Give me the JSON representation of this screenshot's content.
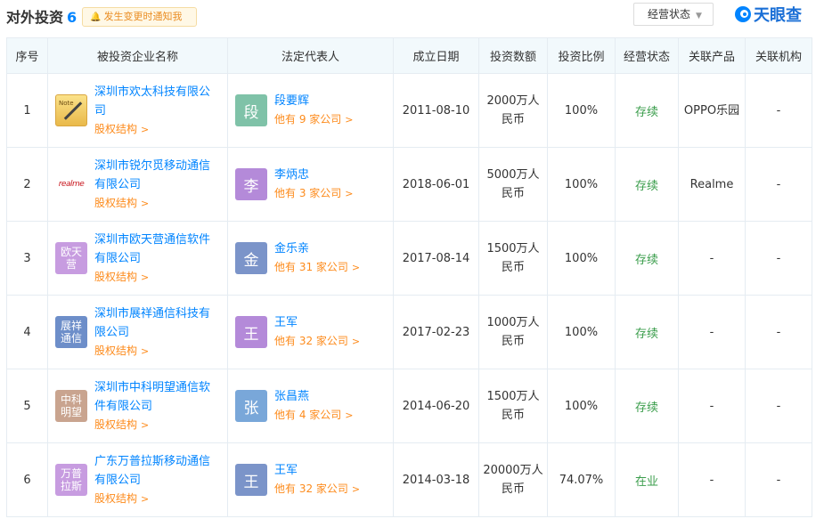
{
  "header": {
    "title": "对外投资",
    "count": "6",
    "notify_label": "发生变更时通知我",
    "status_filter": "经营状态",
    "logo_text": "天眼查"
  },
  "table": {
    "columns": [
      "序号",
      "被投资企业名称",
      "法定代表人",
      "成立日期",
      "投资数额",
      "投资比例",
      "经营状态",
      "关联产品",
      "关联机构"
    ],
    "equity_label": "股权结构",
    "rows": [
      {
        "idx": "1",
        "logo_text": "Note",
        "company": "深圳市欢太科技有限公司",
        "avatar": "段",
        "avatar_color": "#7fc2a8",
        "person": "段要辉",
        "more": "他有 9 家公司",
        "date": "2011-08-10",
        "amount": "2000万人民币",
        "ratio": "100%",
        "status": "存续",
        "product": "OPPO乐园",
        "org": "-"
      },
      {
        "idx": "2",
        "logo_text": "realme",
        "company": "深圳市锐尔觅移动通信有限公司",
        "avatar": "李",
        "avatar_color": "#b48ad9",
        "person": "李炳忠",
        "more": "他有 3 家公司",
        "date": "2018-06-01",
        "amount": "5000万人民币",
        "ratio": "100%",
        "status": "存续",
        "product": "Realme",
        "org": "-"
      },
      {
        "idx": "3",
        "logo_text": "欧天营",
        "company": "深圳市欧天营通信软件有限公司",
        "avatar": "金",
        "avatar_color": "#7b94c9",
        "person": "金乐亲",
        "more": "他有 31 家公司",
        "date": "2017-08-14",
        "amount": "1500万人民币",
        "ratio": "100%",
        "status": "存续",
        "product": "-",
        "org": "-"
      },
      {
        "idx": "4",
        "logo_text": "展祥通信",
        "company": "深圳市展祥通信科技有限公司",
        "avatar": "王",
        "avatar_color": "#b48ad9",
        "person": "王军",
        "more": "他有 32 家公司",
        "date": "2017-02-23",
        "amount": "1000万人民币",
        "ratio": "100%",
        "status": "存续",
        "product": "-",
        "org": "-"
      },
      {
        "idx": "5",
        "logo_text": "中科明望",
        "company": "深圳市中科明望通信软件有限公司",
        "avatar": "张",
        "avatar_color": "#79a7d9",
        "person": "张昌燕",
        "more": "他有 4 家公司",
        "date": "2014-06-20",
        "amount": "1500万人民币",
        "ratio": "100%",
        "status": "存续",
        "product": "-",
        "org": "-"
      },
      {
        "idx": "6",
        "logo_text": "万普拉斯",
        "company": "广东万普拉斯移动通信有限公司",
        "avatar": "王",
        "avatar_color": "#7b94c9",
        "person": "王军",
        "more": "他有 32 家公司",
        "date": "2014-03-18",
        "amount": "20000万人民币",
        "ratio": "74.07%",
        "status": "在业",
        "product": "-",
        "org": "-"
      }
    ]
  },
  "colors": {
    "accent": "#0084ff",
    "orange": "#fd8b1c",
    "status_green": "#3a9d4b",
    "header_bg": "#f2f9fc"
  }
}
